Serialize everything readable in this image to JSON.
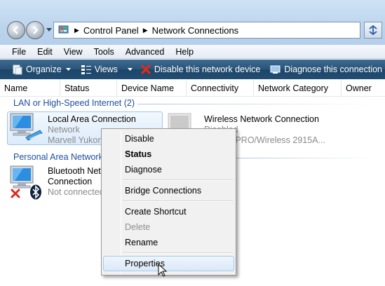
{
  "address": {
    "crumbs": [
      "Control Panel",
      "Network Connections"
    ],
    "icons": {
      "back": "back-arrow-icon",
      "forward": "forward-arrow-icon",
      "refresh": "refresh-icon",
      "folder": "control-panel-icon"
    }
  },
  "menubar": [
    "File",
    "Edit",
    "View",
    "Tools",
    "Advanced",
    "Help"
  ],
  "toolbar": {
    "organize": "Organize",
    "views": "Views",
    "disable": "Disable this network device",
    "diagnose": "Diagnose this connection"
  },
  "columns": [
    "Name",
    "Status",
    "Device Name",
    "Connectivity",
    "Network Category",
    "Owner"
  ],
  "groups": {
    "lan": {
      "title": "LAN or High-Speed Internet (2)",
      "items": [
        {
          "name": "Local Area Connection",
          "status": "Network",
          "device": "Marvell Yukon"
        },
        {
          "name": "Wireless Network Connection",
          "status": "Disabled",
          "device": "Intel(R) PRO/Wireless 2915A..."
        }
      ]
    },
    "pan": {
      "title": "Personal Area Network",
      "items": [
        {
          "name_line1": "Bluetooth Network",
          "name_line2": "Connection",
          "status": "Not connected"
        }
      ]
    }
  },
  "context_menu": {
    "items": [
      "Disable",
      "Status",
      "Diagnose",
      "Bridge Connections",
      "Create Shortcut",
      "Delete",
      "Rename",
      "Properties"
    ],
    "default_item": "Status",
    "disabled_item": "Delete",
    "hovered_item": "Properties"
  },
  "colors": {
    "toolbar_bg": "#224d73",
    "group_title": "#1e4ea0",
    "selection_border": "#9ec6ee"
  }
}
